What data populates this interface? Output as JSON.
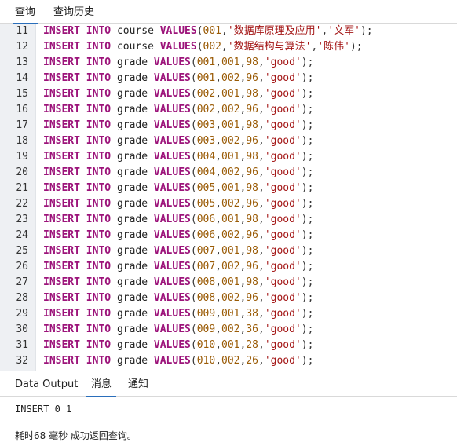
{
  "top_tabs": [
    {
      "label": "查询",
      "active": true
    },
    {
      "label": "查询历史",
      "active": false
    }
  ],
  "editor": {
    "lines": [
      {
        "no": "11",
        "keyword1": "INSERT",
        "keyword2": "INTO",
        "table": "course",
        "keyword3": "VALUES",
        "args": [
          "001",
          "'数据库原理及应用'",
          "'文军'"
        ]
      },
      {
        "no": "12",
        "keyword1": "INSERT",
        "keyword2": "INTO",
        "table": "course",
        "keyword3": "VALUES",
        "args": [
          "002",
          "'数据结构与算法'",
          "'陈伟'"
        ]
      },
      {
        "no": "13",
        "keyword1": "INSERT",
        "keyword2": "INTO",
        "table": "grade",
        "keyword3": "VALUES",
        "args": [
          "001",
          "001",
          "98",
          "'good'"
        ]
      },
      {
        "no": "14",
        "keyword1": "INSERT",
        "keyword2": "INTO",
        "table": "grade",
        "keyword3": "VALUES",
        "args": [
          "001",
          "002",
          "96",
          "'good'"
        ]
      },
      {
        "no": "15",
        "keyword1": "INSERT",
        "keyword2": "INTO",
        "table": "grade",
        "keyword3": "VALUES",
        "args": [
          "002",
          "001",
          "98",
          "'good'"
        ]
      },
      {
        "no": "16",
        "keyword1": "INSERT",
        "keyword2": "INTO",
        "table": "grade",
        "keyword3": "VALUES",
        "args": [
          "002",
          "002",
          "96",
          "'good'"
        ]
      },
      {
        "no": "17",
        "keyword1": "INSERT",
        "keyword2": "INTO",
        "table": "grade",
        "keyword3": "VALUES",
        "args": [
          "003",
          "001",
          "98",
          "'good'"
        ]
      },
      {
        "no": "18",
        "keyword1": "INSERT",
        "keyword2": "INTO",
        "table": "grade",
        "keyword3": "VALUES",
        "args": [
          "003",
          "002",
          "96",
          "'good'"
        ]
      },
      {
        "no": "19",
        "keyword1": "INSERT",
        "keyword2": "INTO",
        "table": "grade",
        "keyword3": "VALUES",
        "args": [
          "004",
          "001",
          "98",
          "'good'"
        ]
      },
      {
        "no": "20",
        "keyword1": "INSERT",
        "keyword2": "INTO",
        "table": "grade",
        "keyword3": "VALUES",
        "args": [
          "004",
          "002",
          "96",
          "'good'"
        ]
      },
      {
        "no": "21",
        "keyword1": "INSERT",
        "keyword2": "INTO",
        "table": "grade",
        "keyword3": "VALUES",
        "args": [
          "005",
          "001",
          "98",
          "'good'"
        ]
      },
      {
        "no": "22",
        "keyword1": "INSERT",
        "keyword2": "INTO",
        "table": "grade",
        "keyword3": "VALUES",
        "args": [
          "005",
          "002",
          "96",
          "'good'"
        ]
      },
      {
        "no": "23",
        "keyword1": "INSERT",
        "keyword2": "INTO",
        "table": "grade",
        "keyword3": "VALUES",
        "args": [
          "006",
          "001",
          "98",
          "'good'"
        ]
      },
      {
        "no": "24",
        "keyword1": "INSERT",
        "keyword2": "INTO",
        "table": "grade",
        "keyword3": "VALUES",
        "args": [
          "006",
          "002",
          "96",
          "'good'"
        ]
      },
      {
        "no": "25",
        "keyword1": "INSERT",
        "keyword2": "INTO",
        "table": "grade",
        "keyword3": "VALUES",
        "args": [
          "007",
          "001",
          "98",
          "'good'"
        ]
      },
      {
        "no": "26",
        "keyword1": "INSERT",
        "keyword2": "INTO",
        "table": "grade",
        "keyword3": "VALUES",
        "args": [
          "007",
          "002",
          "96",
          "'good'"
        ]
      },
      {
        "no": "27",
        "keyword1": "INSERT",
        "keyword2": "INTO",
        "table": "grade",
        "keyword3": "VALUES",
        "args": [
          "008",
          "001",
          "98",
          "'good'"
        ]
      },
      {
        "no": "28",
        "keyword1": "INSERT",
        "keyword2": "INTO",
        "table": "grade",
        "keyword3": "VALUES",
        "args": [
          "008",
          "002",
          "96",
          "'good'"
        ]
      },
      {
        "no": "29",
        "keyword1": "INSERT",
        "keyword2": "INTO",
        "table": "grade",
        "keyword3": "VALUES",
        "args": [
          "009",
          "001",
          "38",
          "'good'"
        ]
      },
      {
        "no": "30",
        "keyword1": "INSERT",
        "keyword2": "INTO",
        "table": "grade",
        "keyword3": "VALUES",
        "args": [
          "009",
          "002",
          "36",
          "'good'"
        ]
      },
      {
        "no": "31",
        "keyword1": "INSERT",
        "keyword2": "INTO",
        "table": "grade",
        "keyword3": "VALUES",
        "args": [
          "010",
          "001",
          "28",
          "'good'"
        ]
      },
      {
        "no": "32",
        "keyword1": "INSERT",
        "keyword2": "INTO",
        "table": "grade",
        "keyword3": "VALUES",
        "args": [
          "010",
          "002",
          "26",
          "'good'"
        ]
      }
    ]
  },
  "bottom_tabs": [
    {
      "label": "Data Output",
      "active": false
    },
    {
      "label": "消息",
      "active": true
    },
    {
      "label": "通知",
      "active": false
    }
  ],
  "messages": {
    "result": "INSERT 0 1",
    "summary": "耗时68 毫秒 成功返回查询。"
  },
  "colors": {
    "keyword": "#9c137a",
    "number": "#9a5b06",
    "string": "#a31515",
    "accent": "#2a6ebb",
    "gutter": "#eef0f3"
  }
}
